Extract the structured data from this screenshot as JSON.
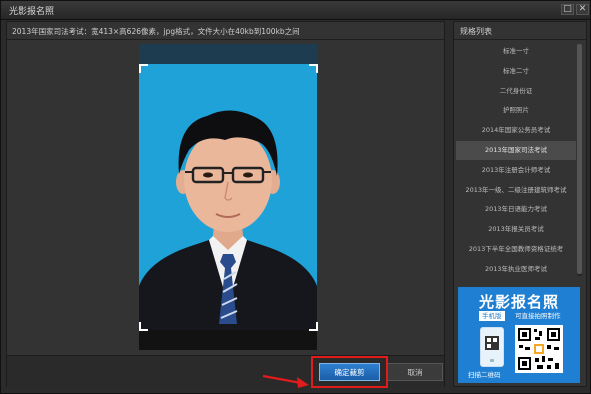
{
  "window": {
    "title": "光影报名照",
    "minimize_icon": "□",
    "close_icon": "✕"
  },
  "main": {
    "hint": "2013年国家司法考试：宽413×高626像素，jpg格式，文件大小在40kb到100kb之间"
  },
  "buttons": {
    "confirm": "确定裁剪",
    "cancel": "取消"
  },
  "sidebar": {
    "title": "规格列表",
    "selected_index": 5,
    "items": [
      "标准一寸",
      "标准二寸",
      "二代身份证",
      "护照照片",
      "2014年国家公务员考试",
      "2013年国家司法考试",
      "2013年注册会计师考试",
      "2013年一级、二级注册建筑师考试",
      "2013年日语能力考试",
      "2013年报关员考试",
      "2013下半年全国教师资格证统考",
      "2013年执业医师考试"
    ]
  },
  "ad": {
    "title": "光影报名照",
    "badge": "手机版",
    "subtitle": "可直接拍照制作",
    "scan": "扫描二维码"
  },
  "colors": {
    "accent": "#1f7fd2",
    "photo_background": "#1ea2d8",
    "highlight_box": "#e21b1b"
  }
}
